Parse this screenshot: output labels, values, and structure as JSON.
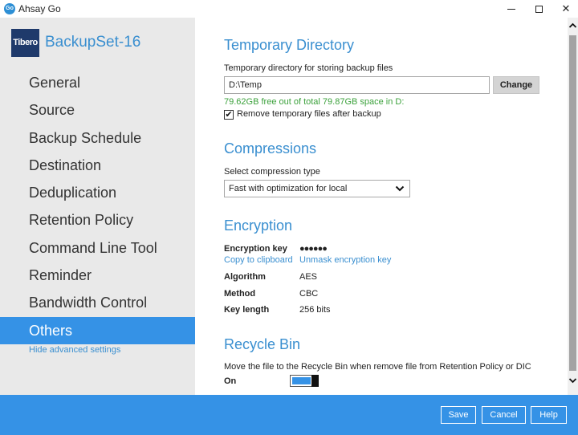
{
  "window": {
    "title": "Ahsay Go",
    "icon_text": "Go",
    "minimize_icon": "minimize-icon",
    "maximize_icon": "maximize-icon",
    "close_icon": "close-icon",
    "close_glyph": "✕"
  },
  "sidebar": {
    "logo_text": "Tibero",
    "backup_set_name": "BackupSet-16",
    "items": [
      {
        "label": "General",
        "active": false
      },
      {
        "label": "Source",
        "active": false
      },
      {
        "label": "Backup Schedule",
        "active": false
      },
      {
        "label": "Destination",
        "active": false
      },
      {
        "label": "Deduplication",
        "active": false
      },
      {
        "label": "Retention Policy",
        "active": false
      },
      {
        "label": "Command Line Tool",
        "active": false
      },
      {
        "label": "Reminder",
        "active": false
      },
      {
        "label": "Bandwidth Control",
        "active": false
      },
      {
        "label": "Others",
        "active": true
      }
    ],
    "hide_advanced_label": "Hide advanced settings"
  },
  "temp_dir": {
    "title": "Temporary Directory",
    "label": "Temporary directory for storing backup files",
    "value": "D:\\Temp",
    "change_label": "Change",
    "space_info": "79.62GB free out of total 79.87GB space in D:",
    "remove_checked": true,
    "check_glyph": "✔",
    "remove_label": "Remove temporary files after backup"
  },
  "compressions": {
    "title": "Compressions",
    "label": "Select compression type",
    "selected": "Fast with optimization for local"
  },
  "encryption": {
    "title": "Encryption",
    "key_label": "Encryption key",
    "key_value": "●●●●●●",
    "copy_link": "Copy to clipboard",
    "unmask_link": "Unmask encryption key",
    "algorithm_label": "Algorithm",
    "algorithm_value": "AES",
    "method_label": "Method",
    "method_value": "CBC",
    "key_length_label": "Key length",
    "key_length_value": "256 bits"
  },
  "recycle_bin": {
    "title": "Recycle Bin",
    "label": "Move the file to the Recycle Bin when remove file from Retention Policy or DIC",
    "toggle_label": "On",
    "toggle_on": true
  },
  "footer": {
    "save_label": "Save",
    "cancel_label": "Cancel",
    "help_label": "Help"
  },
  "colors": {
    "accent": "#3592e6",
    "link": "#3a8fd0",
    "success": "#3ba13b",
    "sidebar_bg": "#e9e9e9"
  }
}
